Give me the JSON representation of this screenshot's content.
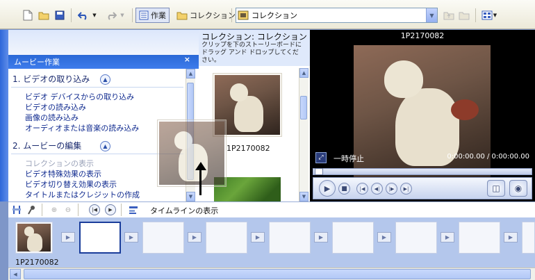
{
  "toolbar": {
    "tasks_label": "作業",
    "collections_label": "コレクション",
    "collection_select_value": "コレクション"
  },
  "task_pane": {
    "title": "ムービー作業",
    "close_glyph": "×",
    "sections": [
      {
        "title": "1. ビデオの取り込み",
        "links": [
          "ビデオ デバイスからの取り込み",
          "ビデオの読み込み",
          "画像の読み込み",
          "オーディオまたは音楽の読み込み"
        ]
      },
      {
        "title": "2. ムービーの編集",
        "links": [
          "コレクションの表示",
          "ビデオ特殊効果の表示",
          "ビデオ切り替え効果の表示",
          "タイトルまたはクレジットの作成"
        ]
      }
    ]
  },
  "collection_pane": {
    "title": "コレクション: コレクション",
    "hint": "クリップを下のストーリーボードにドラッグ アンド ドロップしてください。",
    "clip_name": "1P2170082"
  },
  "monitor": {
    "title": "1P2170082",
    "status": "一時停止",
    "time": "0:00:00.00 / 0:00:00.00"
  },
  "storyboard": {
    "timeline_label": "タイムラインの表示",
    "clip_label": "1P2170082"
  },
  "colors": {
    "taskpane_header": "#2a68d6",
    "storyboard_bg": "#b4c7ec",
    "arrow_red": "#e51b1b"
  }
}
